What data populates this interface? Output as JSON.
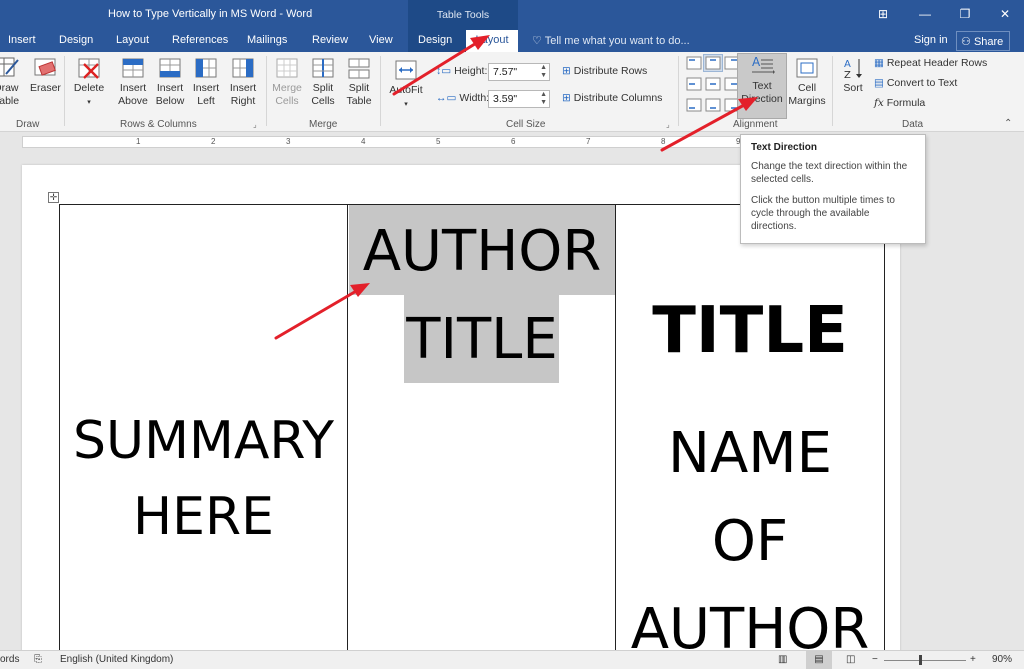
{
  "window": {
    "doc_title": "How to Type Vertically in MS Word - Word",
    "contextual_group": "Table Tools",
    "controls": [
      "⊞",
      "—",
      "❐",
      "✕"
    ]
  },
  "tabs": {
    "items": [
      "Insert",
      "Design",
      "Layout",
      "References",
      "Mailings",
      "Review",
      "View"
    ],
    "contextual": [
      "Design",
      "Layout"
    ],
    "tell_me": "Tell me what you want to do...",
    "sign_in": "Sign in",
    "share": "Share"
  },
  "ribbon": {
    "draw": {
      "draw_table": "Draw\nTable",
      "eraser": "Eraser",
      "label": "Draw"
    },
    "rows_columns": {
      "delete": "Delete",
      "insert_above": "Insert\nAbove",
      "insert_below": "Insert\nBelow",
      "insert_left": "Insert\nLeft",
      "insert_right": "Insert\nRight",
      "label": "Rows & Columns"
    },
    "merge": {
      "merge_cells": "Merge\nCells",
      "split_cells": "Split\nCells",
      "split_table": "Split\nTable",
      "label": "Merge"
    },
    "autofit": "AutoFit",
    "cell_size": {
      "height_label": "Height:",
      "height_value": "7.57\"",
      "width_label": "Width:",
      "width_value": "3.59\"",
      "distribute_rows": "Distribute Rows",
      "distribute_columns": "Distribute Columns",
      "label": "Cell Size"
    },
    "alignment": {
      "text_direction": "Text\nDirection",
      "cell_margins": "Cell\nMargins",
      "label": "Alignment"
    },
    "data": {
      "sort": "Sort",
      "repeat_header_rows": "Repeat Header Rows",
      "convert_to_text": "Convert to Text",
      "formula": "Formula",
      "label": "Data"
    }
  },
  "ruler": {
    "numbers": [
      "1",
      "2",
      "3",
      "4",
      "5",
      "6",
      "7",
      "8",
      "9"
    ]
  },
  "document": {
    "col1": [
      "SUMMARY",
      "HERE"
    ],
    "col2": [
      "AUTHOR",
      "TITLE"
    ],
    "col3_title": "TITLE",
    "col3_name": [
      "NAME",
      "OF",
      "AUTHOR"
    ]
  },
  "tooltip": {
    "title": "Text Direction",
    "line1": "Change the text direction within the selected cells.",
    "line2": "Click the button multiple times to cycle through the available directions."
  },
  "status": {
    "words": "ords",
    "language": "English (United Kingdom)",
    "zoom": "90%"
  },
  "colors": {
    "accent": "#2b579a",
    "arrow": "#e3202a"
  }
}
